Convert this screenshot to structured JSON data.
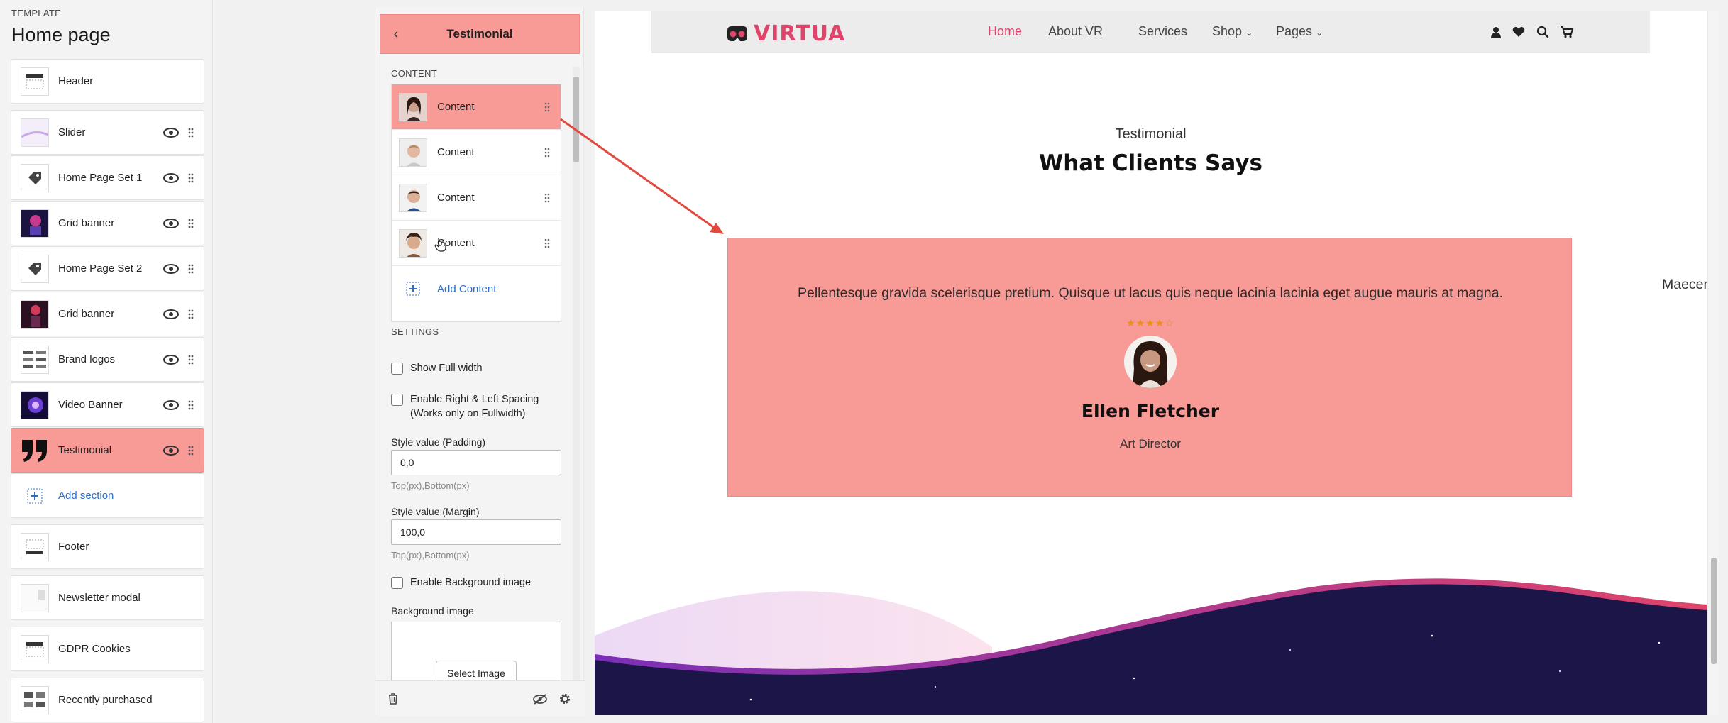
{
  "template": {
    "label": "TEMPLATE",
    "title": "Home page"
  },
  "sections": [
    {
      "label": "Header",
      "icon": "header-icon"
    },
    {
      "label": "Slider",
      "icon": "slider-thumbnail"
    },
    {
      "label": "Home Page Set 1",
      "icon": "tag-icon"
    },
    {
      "label": "Grid banner",
      "icon": "grid-banner-thumbnail"
    },
    {
      "label": "Home Page Set 2",
      "icon": "tag-icon"
    },
    {
      "label": "Grid banner",
      "icon": "grid-banner-thumbnail"
    },
    {
      "label": "Brand logos",
      "icon": "brand-logos-thumbnail"
    },
    {
      "label": "Video Banner",
      "icon": "video-banner-thumbnail"
    },
    {
      "label": "Testimonial",
      "icon": "quote-icon",
      "active": true
    },
    {
      "label": "Add section",
      "icon": "add-section-icon"
    },
    {
      "label": "Footer",
      "icon": "footer-icon"
    },
    {
      "label": "Newsletter modal",
      "icon": "newsletter-thumbnail"
    },
    {
      "label": "GDPR Cookies",
      "icon": "cookies-icon"
    },
    {
      "label": "Recently purchased",
      "icon": "recently-purchased-thumbnail"
    }
  ],
  "panel": {
    "title": "Testimonial",
    "content_heading": "CONTENT",
    "content_items": [
      {
        "label": "Content",
        "avatar": "woman-avatar"
      },
      {
        "label": "Content",
        "avatar": "man-avatar"
      },
      {
        "label": "Content",
        "avatar": "man-avatar"
      },
      {
        "label": "Content",
        "avatar": "man-avatar"
      }
    ],
    "add_content": "Add Content",
    "settings_heading": "SETTINGS",
    "show_full_width": "Show Full width",
    "enable_spacing_line1": "Enable Right & Left Spacing",
    "enable_spacing_line2": "(Works only on Fullwidth)",
    "padding_label": "Style value (Padding)",
    "padding_value": "0,0",
    "padding_help": "Top(px),Bottom(px)",
    "margin_label": "Style value (Margin)",
    "margin_value": "100,0",
    "margin_help": "Top(px),Bottom(px)",
    "enable_bg": "Enable Background image",
    "bg_label": "Background image",
    "select_image": "Select Image"
  },
  "preview": {
    "logo_text": "VIRTUA",
    "nav": [
      "Home",
      "About VR",
      "Services",
      "Shop",
      "Pages"
    ],
    "section_subtitle": "Testimonial",
    "section_title": "What Clients Says",
    "quote": "Pellentesque gravida scelerisque pretium. Quisque ut lacus quis neque lacinia lacinia eget augue mauris at magna.",
    "rating": "4 of 5 stars",
    "rating_value": 4,
    "name": "Ellen Fletcher",
    "role": "Art Director",
    "next_peek": "Maecen"
  },
  "colors": {
    "highlight": "#f89a96",
    "brand": "#e0446b",
    "link": "#2f6fc3",
    "star": "#e88f1c"
  }
}
